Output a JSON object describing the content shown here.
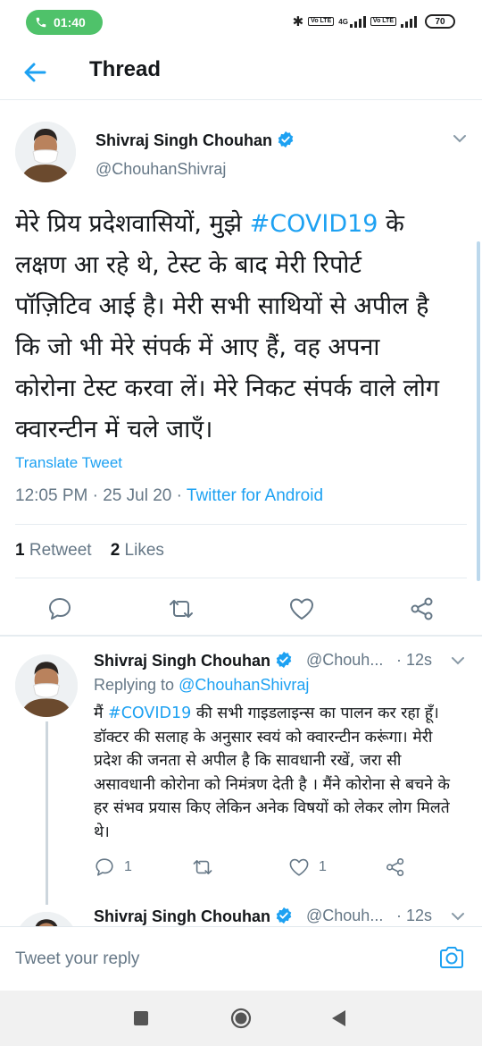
{
  "status_bar": {
    "time": "01:40",
    "network": "4G",
    "volte": "Vo LTE",
    "battery": "70"
  },
  "header": {
    "title": "Thread"
  },
  "main_tweet": {
    "author_name": "Shivraj Singh Chouhan",
    "handle": "@ChouhanShivraj",
    "body_before": "मेरे प्रिय प्रदेशवासियों, मुझे ",
    "hashtag": "#COVID19",
    "body_after": " के लक्षण आ रहे थे, टेस्ट के बाद मेरी रिपोर्ट पॉज़िटिव आई है। मेरी सभी साथियों से अपील है कि जो भी मेरे संपर्क में आए हैं, वह अपना कोरोना टेस्ट करवा लें। मेरे निकट संपर्क वाले लोग क्वारन्टीन में चले जाएँ।",
    "translate_label": "Translate Tweet",
    "time": "12:05 PM",
    "date": "25 Jul 20",
    "source": "Twitter for Android",
    "retweet_count": "1",
    "retweet_label": "Retweet",
    "like_count": "2",
    "like_label": "Likes"
  },
  "replies": [
    {
      "author_name": "Shivraj Singh Chouhan",
      "handle": "@Chouh...",
      "age": "· 12s",
      "replying_label": "Replying to",
      "replying_to": "@ChouhanShivraj",
      "body_before": "मैं ",
      "hashtag": "#COVID19",
      "body_after": " की सभी गाइडलाइन्स का पालन कर रहा हूँ। डॉक्टर की सलाह के अनुसार स्वयं को क्वारन्टीन करूंगा। मेरी प्रदेश की जनता से अपील है कि सावधानी रखें, जरा सी असावधानी कोरोना को निमंत्रण देती है । मैंने कोरोना से बचने के हर संभव प्रयास किए लेकिन अनेक विषयों को लेकर लोग मिलते थे।",
      "reply_count": "1",
      "like_count": "1"
    },
    {
      "author_name": "Shivraj Singh Chouhan",
      "handle": "@Chouh...",
      "age": "· 12s"
    }
  ],
  "composer": {
    "placeholder": "Tweet your reply"
  },
  "colors": {
    "accent": "#1da1f2",
    "secondary_text": "#657786",
    "call_pill": "#4fc26a"
  },
  "icons": [
    "phone-icon",
    "bluetooth-icon",
    "back-arrow-icon",
    "verified-badge-icon",
    "chevron-down-icon",
    "reply-icon",
    "retweet-icon",
    "like-icon",
    "share-icon",
    "camera-icon",
    "nav-recents-icon",
    "nav-home-icon",
    "nav-back-icon"
  ]
}
